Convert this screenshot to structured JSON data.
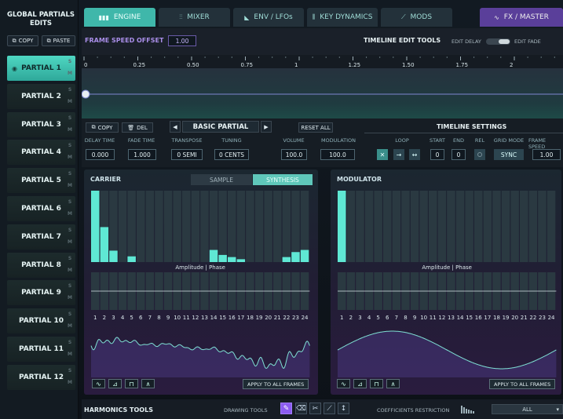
{
  "sidebar": {
    "title": "GLOBAL PARTIALS EDITS",
    "copy_label": "COPY",
    "paste_label": "PASTE",
    "partials": [
      "PARTIAL 1",
      "PARTIAL 2",
      "PARTIAL 3",
      "PARTIAL 4",
      "PARTIAL 5",
      "PARTIAL 6",
      "PARTIAL 7",
      "PARTIAL 8",
      "PARTIAL 9",
      "PARTIAL 10",
      "PARTIAL 11",
      "PARTIAL 12"
    ],
    "active_index": 0,
    "solo_label": "S",
    "mute_label": "M"
  },
  "tabs": [
    {
      "label": "ENGINE",
      "icon": "bars-icon"
    },
    {
      "label": "MIXER",
      "icon": "sliders-icon"
    },
    {
      "label": "ENV / LFOs",
      "icon": "envelope-icon"
    },
    {
      "label": "KEY DYNAMICS",
      "icon": "keys-icon"
    },
    {
      "label": "MODS",
      "icon": "mods-icon"
    },
    {
      "label": "FX / MASTER",
      "icon": "wave-icon"
    }
  ],
  "topstrip": {
    "frame_speed_label": "FRAME SPEED OFFSET",
    "frame_speed_value": "1.00",
    "timeline_tools_label": "TIMELINE EDIT TOOLS",
    "edit_delay_label": "EDIT DELAY",
    "edit_fade_label": "EDIT FADE"
  },
  "ruler": {
    "ticks": [
      "0",
      "0.25",
      "0.50",
      "0.75",
      "1",
      "1.25",
      "1.50",
      "1.75",
      "2",
      "2"
    ]
  },
  "controls": {
    "copy_label": "COPY",
    "del_label": "DEL",
    "preset_name": "BASIC PARTIAL",
    "reset_label": "RESET ALL",
    "timeline_settings_label": "TIMELINE SETTINGS",
    "delay_time_label": "DELAY TIME",
    "delay_time_value": "0.000",
    "fade_time_label": "FADE TIME",
    "fade_time_value": "1.000",
    "transpose_label": "TRANSPOSE",
    "transpose_value": "0 SEMI",
    "tuning_label": "TUNING",
    "tuning_value": "0 CENTS",
    "volume_label": "VOLUME",
    "volume_value": "100.0",
    "modulation_label": "MODULATION",
    "modulation_value": "100.0",
    "loop_label": "LOOP",
    "start_label": "START",
    "start_value": "0",
    "end_label": "END",
    "end_value": "0",
    "rel_label": "REL",
    "grid_mode_label": "GRID MODE",
    "grid_mode_value": "SYNC",
    "frame_speed_label": "FRAME SPEED",
    "frame_speed_value": "1.00"
  },
  "carrier": {
    "title": "CARRIER",
    "tab_sample": "SAMPLE",
    "tab_synthesis": "SYNTHESIS",
    "divider_label": "Amplitude | Phase",
    "apply_label": "APPLY TO ALL FRAMES",
    "amplitudes": [
      1.0,
      0.49,
      0.16,
      0,
      0.08,
      0,
      0,
      0,
      0,
      0,
      0,
      0,
      0,
      0.17,
      0.1,
      0.07,
      0.04,
      0,
      0,
      0,
      0,
      0.07,
      0.14,
      0.17
    ]
  },
  "modulator": {
    "title": "MODULATOR",
    "divider_label": "Amplitude | Phase",
    "apply_label": "APPLY TO ALL FRAMES",
    "amplitudes": [
      1.0,
      0,
      0,
      0,
      0,
      0,
      0,
      0,
      0,
      0,
      0,
      0,
      0,
      0,
      0,
      0,
      0,
      0,
      0,
      0,
      0,
      0,
      0,
      0
    ]
  },
  "harmonic_labels": [
    "1",
    "2",
    "3",
    "4",
    "5",
    "6",
    "7",
    "8",
    "9",
    "10",
    "11",
    "12",
    "13",
    "14",
    "15",
    "16",
    "17",
    "18",
    "19",
    "20",
    "21",
    "22",
    "23",
    "24"
  ],
  "bottom": {
    "harmonics_tools_label": "HARMONICS TOOLS",
    "drawing_tools_label": "DRAWING TOOLS",
    "coeff_label": "COEFFICIENTS RESTRICTION",
    "coeff_value": "ALL"
  },
  "colors": {
    "accent": "#5fe8d4",
    "purple": "#8b5cf0",
    "fx_tab": "#5a3f9a"
  }
}
